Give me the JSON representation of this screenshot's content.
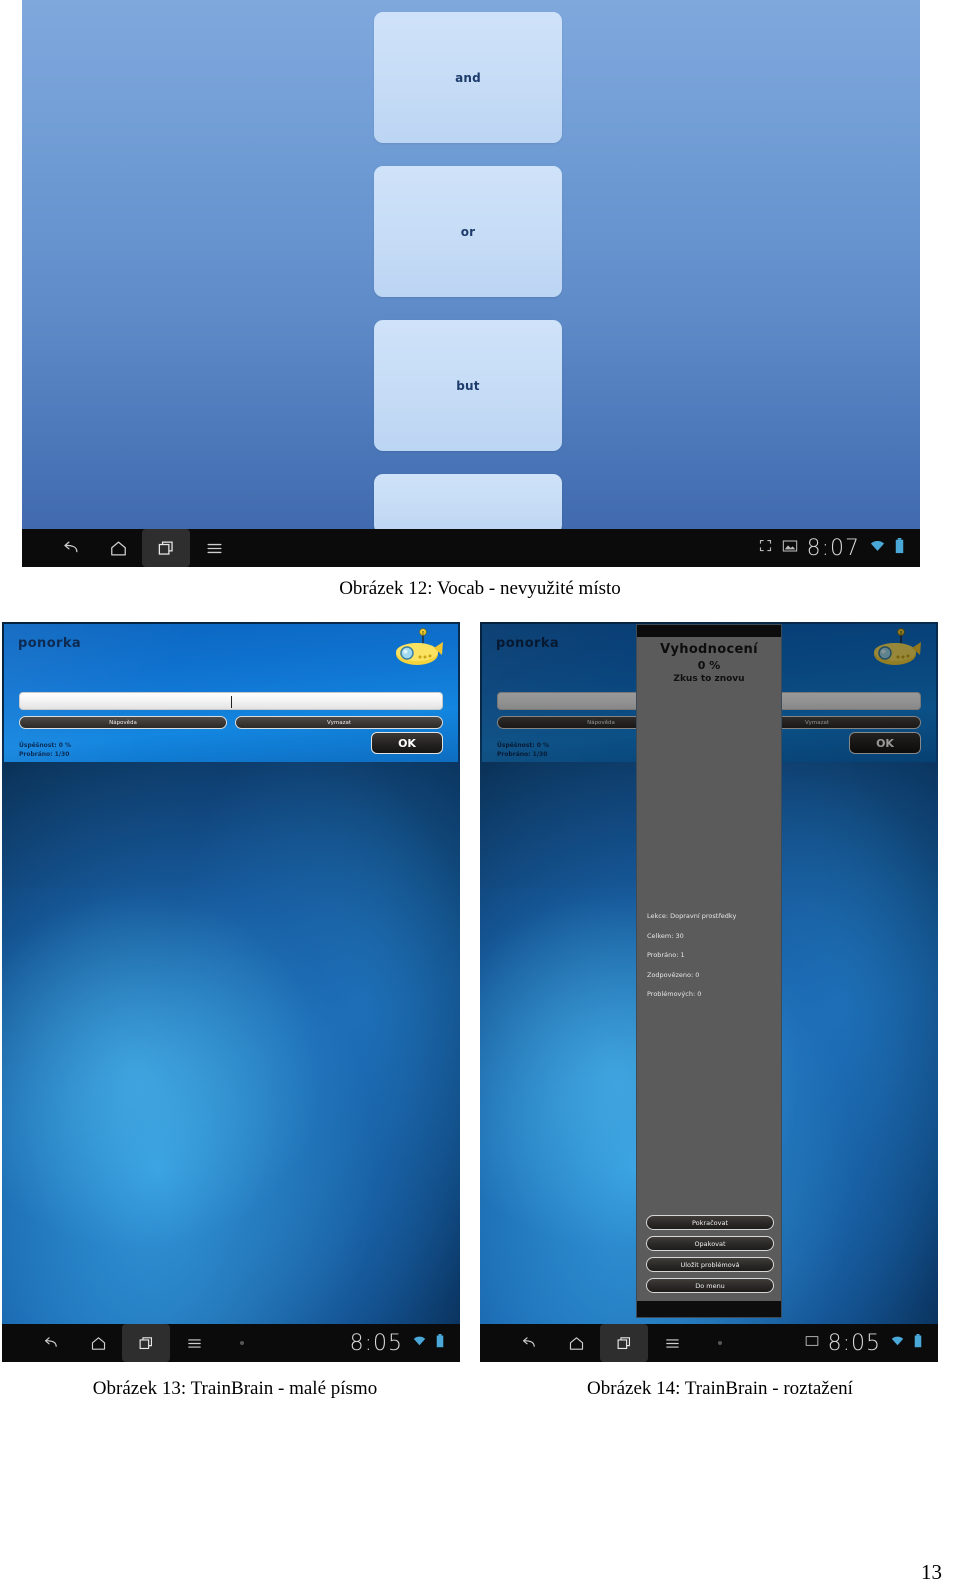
{
  "page": {
    "number": "13"
  },
  "figure12": {
    "caption": "Obrázek 12: Vocab - nevyužité místo",
    "cards": [
      {
        "label": "and"
      },
      {
        "label": "or"
      },
      {
        "label": "but"
      },
      {
        "label": ""
      }
    ],
    "statusbar": {
      "time": "8:07",
      "icons": [
        "back-icon",
        "home-icon",
        "recent-apps-icon",
        "menu-icon",
        "fullscreen-icon",
        "screenshot-icon",
        "wifi-icon",
        "battery-icon"
      ]
    },
    "background_color": "#6f9bd4",
    "card_color": "#c6dcf6"
  },
  "figure13": {
    "caption": "Obrázek 13: TrainBrain - malé písmo",
    "app": {
      "title": "ponorka",
      "input_value": "",
      "buttons": {
        "hint": "Nápověda",
        "clear": "Vymazat",
        "ok": "OK"
      },
      "stats": [
        "Úspěšnost: 0 %",
        "Probráno: 1/30"
      ]
    },
    "statusbar": {
      "time": "8:05"
    }
  },
  "figure14": {
    "caption": "Obrázek 14: TrainBrain - roztažení",
    "app": {
      "title": "ponorka",
      "input_value": "",
      "buttons": {
        "hint": "Nápověda",
        "clear": "Vymazat",
        "ok": "OK"
      },
      "stats": [
        "Úspěšnost: 0 %",
        "Probráno: 1/30"
      ]
    },
    "dialog": {
      "heading": "Vyhodnocení",
      "percent": "0 %",
      "subtitle": "Zkus to znovu",
      "stats": [
        "Lekce: Dopravní prostředky",
        "Celkem: 30",
        "Probráno: 1",
        "Zodpovězeno: 0",
        "Problémových: 0"
      ],
      "actions": [
        "Pokračovat",
        "Opakovat",
        "Uložit problémová",
        "Do menu"
      ]
    },
    "statusbar": {
      "time": "8:05"
    }
  }
}
